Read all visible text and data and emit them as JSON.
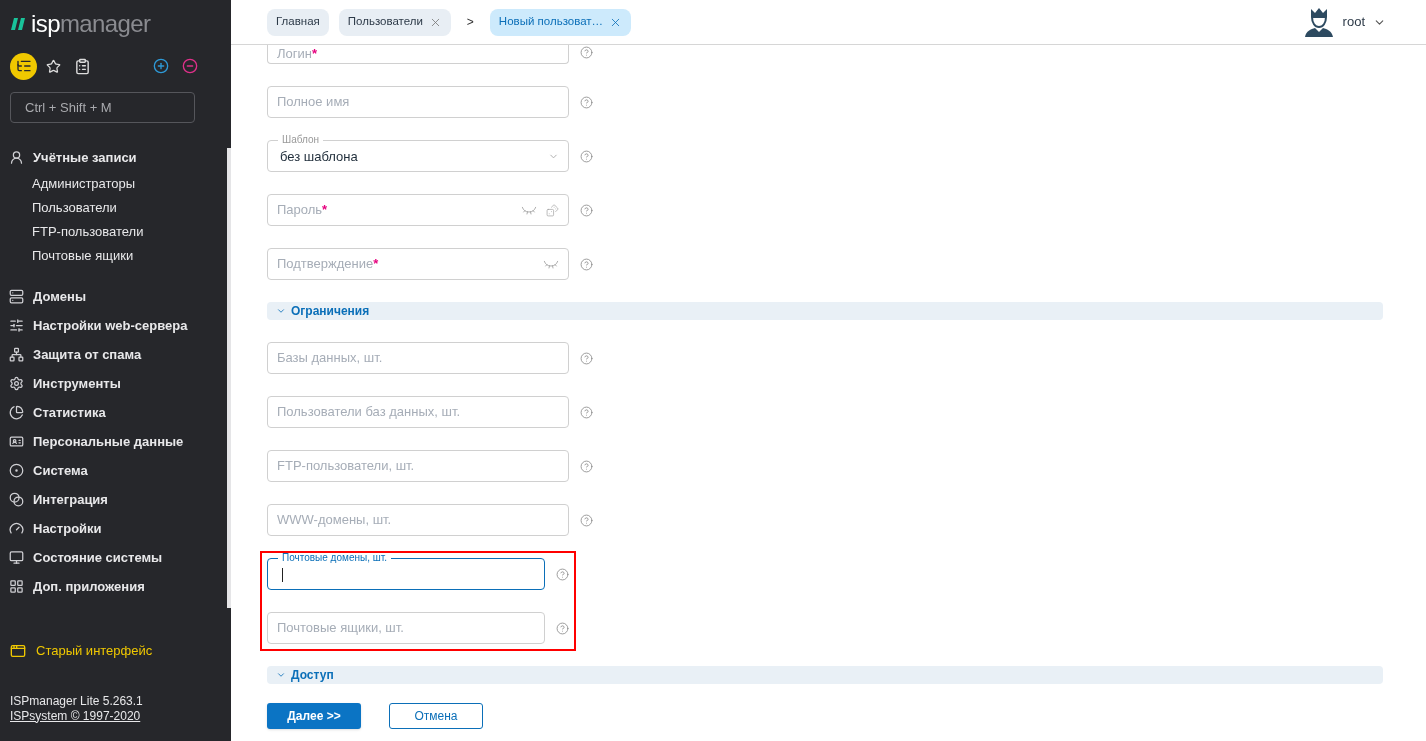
{
  "sidebar": {
    "logo": {
      "part_1": "isp",
      "part_2": "manager"
    },
    "search": {
      "placeholder": "Ctrl + Shift + M"
    },
    "menu": [
      {
        "label": "Учётные записи",
        "children": [
          {
            "label": "Администраторы"
          },
          {
            "label": "Пользователи"
          },
          {
            "label": "FTP-пользователи"
          },
          {
            "label": "Почтовые ящики"
          }
        ]
      },
      {
        "label": "Домены"
      },
      {
        "label": "Настройки web-сервера"
      },
      {
        "label": "Защита от спама"
      },
      {
        "label": "Инструменты"
      },
      {
        "label": "Статистика"
      },
      {
        "label": "Персональные данные"
      },
      {
        "label": "Система"
      },
      {
        "label": "Интеграция"
      },
      {
        "label": "Настройки"
      },
      {
        "label": "Состояние системы"
      },
      {
        "label": "Доп. приложения"
      }
    ],
    "old_interface_link": "Старый интерфейс",
    "footer": {
      "version": "ISPmanager Lite 5.263.1",
      "copyright_link": "ISPsystem © 1997-2020"
    }
  },
  "breadcrumbs": [
    {
      "kind": "tab",
      "label": "Главная",
      "closable": false,
      "selected": false
    },
    {
      "kind": "tab",
      "label": "Пользователи",
      "closable": true,
      "selected": false
    },
    {
      "kind": "separator",
      "label": ">"
    },
    {
      "kind": "tab",
      "label": "Новый пользоват…",
      "closable": true,
      "selected": true
    }
  ],
  "user": {
    "name": "root"
  },
  "form": {
    "items": [
      {
        "kind": "login",
        "placeholder": "Логин",
        "required_mark": "*"
      },
      {
        "kind": "text",
        "placeholder": "Полное имя",
        "focused": false
      },
      {
        "kind": "select",
        "label": "Шаблон",
        "value": "без шаблона"
      },
      {
        "kind": "password",
        "placeholder": "Пароль",
        "required_mark": "*",
        "generator": true
      },
      {
        "kind": "password",
        "placeholder": "Подтверждение",
        "required_mark": "*",
        "generator": false
      },
      {
        "kind": "section",
        "title": "Ограничения"
      },
      {
        "kind": "text",
        "placeholder": "Базы данных, шт.",
        "focused": false
      },
      {
        "kind": "text",
        "placeholder": "Пользователи баз данных, шт.",
        "focused": false
      },
      {
        "kind": "text",
        "placeholder": "FTP-пользователи, шт.",
        "focused": false
      },
      {
        "kind": "text",
        "placeholder": "WWW-домены, шт.",
        "focused": false
      },
      {
        "kind": "text",
        "placeholder": "Почтовые домены, шт.",
        "focused": true,
        "highlighted": true
      },
      {
        "kind": "text",
        "placeholder": "Почтовые ящики, шт.",
        "focused": false,
        "highlighted": true
      },
      {
        "kind": "section",
        "title": "Доступ"
      }
    ],
    "buttons": [
      {
        "kind": "primary",
        "label": "Далее >>"
      },
      {
        "kind": "secondary",
        "label": "Отмена"
      }
    ]
  }
}
